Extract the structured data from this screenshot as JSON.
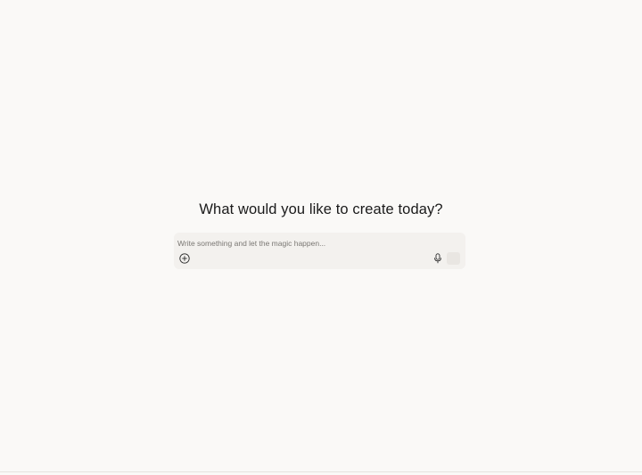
{
  "main": {
    "heading": "What would you like to create today?"
  },
  "composer": {
    "placeholder": "Write something and let the magic happen...",
    "value": "",
    "icons": {
      "add": "plus-circle-icon",
      "microphone": "microphone-icon",
      "send": "send-icon"
    }
  },
  "colors": {
    "background": "#faf9f7",
    "composer_background": "#f3f1ee",
    "text": "#1a1a1a",
    "placeholder": "#7a7773",
    "send_button_disabled": "#e9e6e2"
  }
}
